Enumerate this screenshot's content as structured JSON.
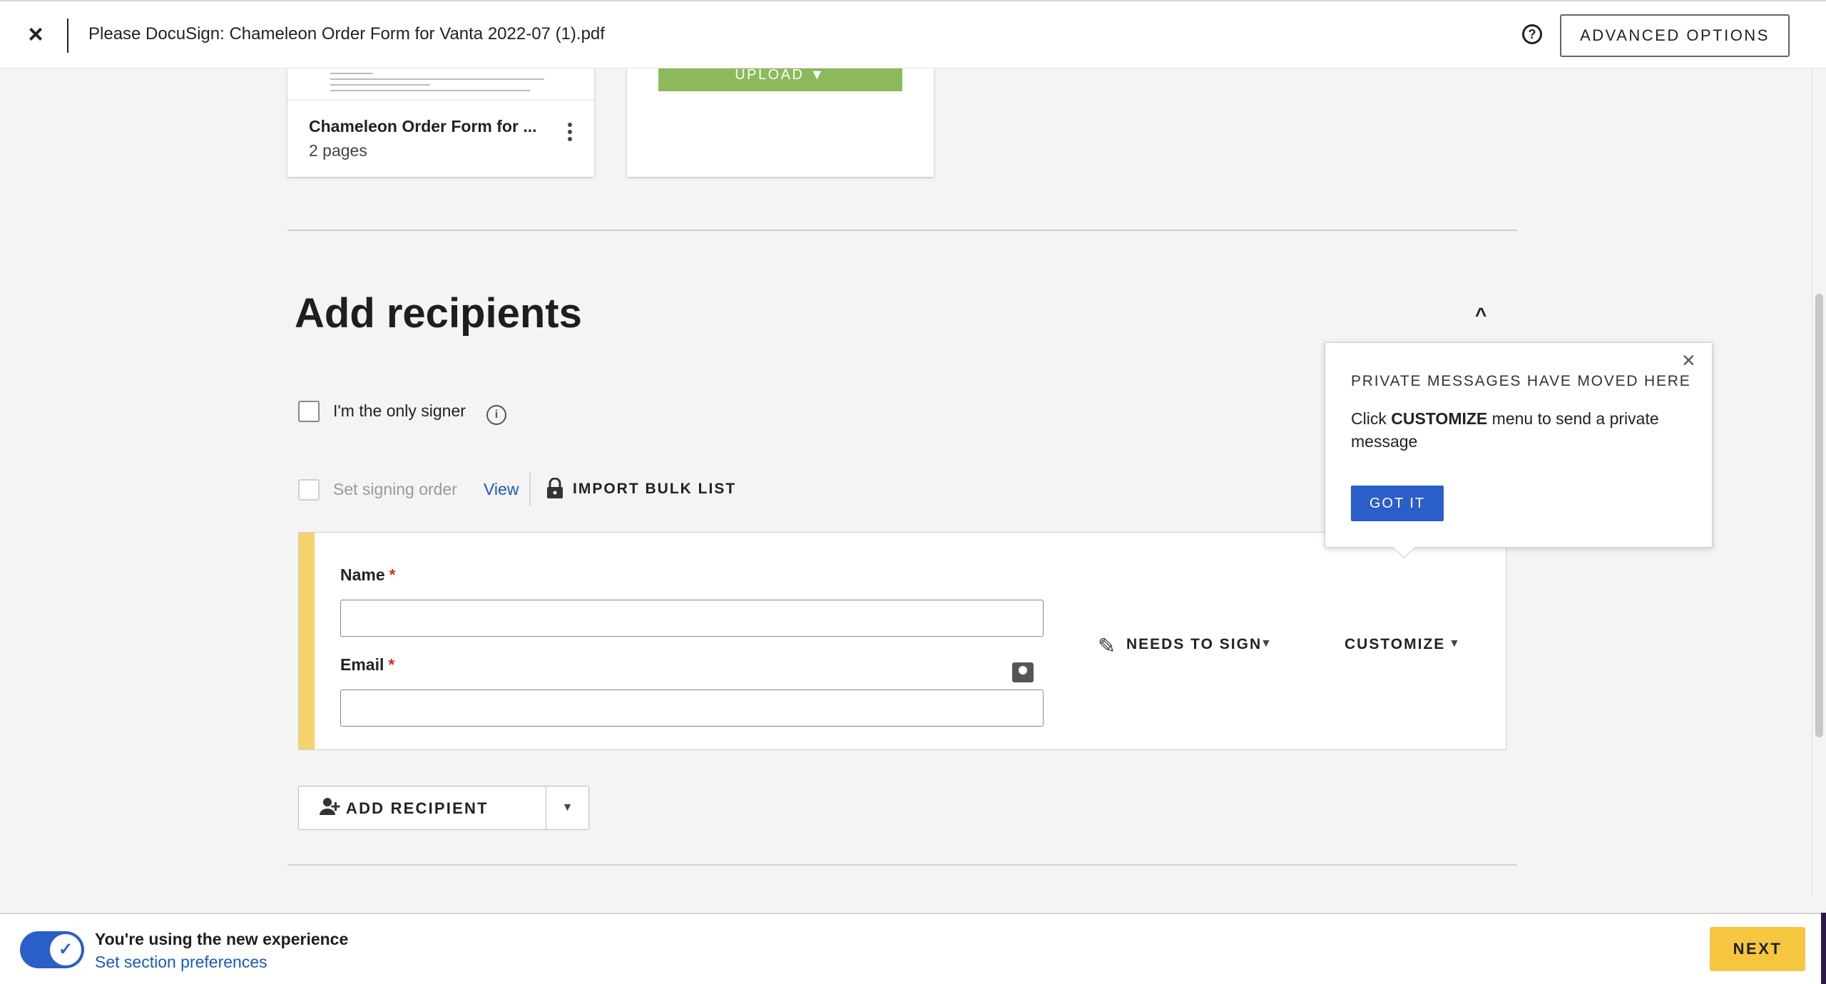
{
  "header": {
    "close_label": "×",
    "title": "Please DocuSign: Chameleon Order Form for Vanta 2022-07 (1).pdf",
    "help_label": "?",
    "advanced_label": "ADVANCED OPTIONS"
  },
  "documents": {
    "name": "Chameleon Order Form for ...",
    "pages": "2 pages",
    "upload_label": "UPLOAD ▼"
  },
  "recipients": {
    "title": "Add recipients",
    "collapse_label": "^",
    "only_signer_label": "I'm the only signer",
    "info_label": "i",
    "signing_order_label": "Set signing order",
    "view_label": "View",
    "import_bulk_label": "IMPORT BULK LIST",
    "recipient": {
      "name_label": "Name",
      "email_label": "Email",
      "required_mark": "*",
      "name_value": "",
      "email_value": "",
      "role_label": "NEEDS TO SIGN",
      "customize_label": "CUSTOMIZE",
      "caret": "▼"
    },
    "add_recipient_label": "ADD RECIPIENT",
    "add_caret": "▼"
  },
  "popover": {
    "close_label": "×",
    "title": "PRIVATE MESSAGES HAVE MOVED HERE",
    "msg_prefix": "Click ",
    "msg_bold": "CUSTOMIZE",
    "msg_suffix": " menu to send a private message",
    "button_label": "GOT IT"
  },
  "footer": {
    "toggle_check": "✓",
    "experience_title": "You're using the new experience",
    "preferences_link": "Set section preferences",
    "next_label": "NEXT"
  },
  "colors": {
    "accent_blue": "#2a5ec8",
    "link_blue": "#1a5bb5",
    "next_yellow": "#f7c641",
    "recipient_stripe": "#f5d36b",
    "upload_green": "#8cb95c"
  }
}
